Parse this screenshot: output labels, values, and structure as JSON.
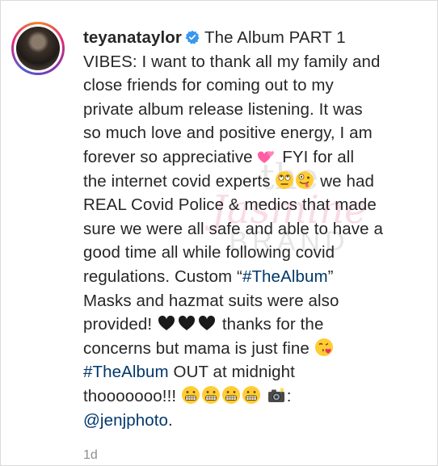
{
  "post": {
    "username": "teyanataylor",
    "lines": [
      "The Album PART 1",
      "VIBES: I want to thank all my family and",
      "close friends for coming out to my",
      "private album release listening. It was",
      "so much love and positive energy, I am",
      "forever so appreciative",
      "FYI for all",
      "the internet covid experts",
      "we had",
      "REAL Covid Police & medics that made",
      "sure we were all safe and able to have a",
      "good time all while following covid",
      "regulations. Custom “",
      "#TheAlbum",
      "”",
      "Masks and hazmat suits were also",
      "provided!",
      "thanks for the",
      "concerns but mama is just fine",
      "#TheAlbum",
      " OUT at midnight",
      "thooooooo!!!",
      ":",
      "@jenjphoto",
      "."
    ],
    "timestamp": "1d"
  },
  "watermark": {
    "top": "the",
    "middle": "Jasmine",
    "bottom": "BRAND"
  },
  "icons": {
    "verified": "verified-badge-icon",
    "sparkling_hearts": "two-hearts-emoji",
    "rolling_eyes": "face-rolling-eyes-emoji",
    "zany": "zany-face-emoji",
    "black_heart": "black-heart-emoji",
    "kiss": "face-blowing-kiss-emoji",
    "grimace": "grimacing-face-emoji",
    "camera": "camera-flash-emoji"
  },
  "colors": {
    "text": "#262626",
    "link": "#00376b",
    "verified": "#3897f0",
    "muted": "#8e8e8e"
  }
}
